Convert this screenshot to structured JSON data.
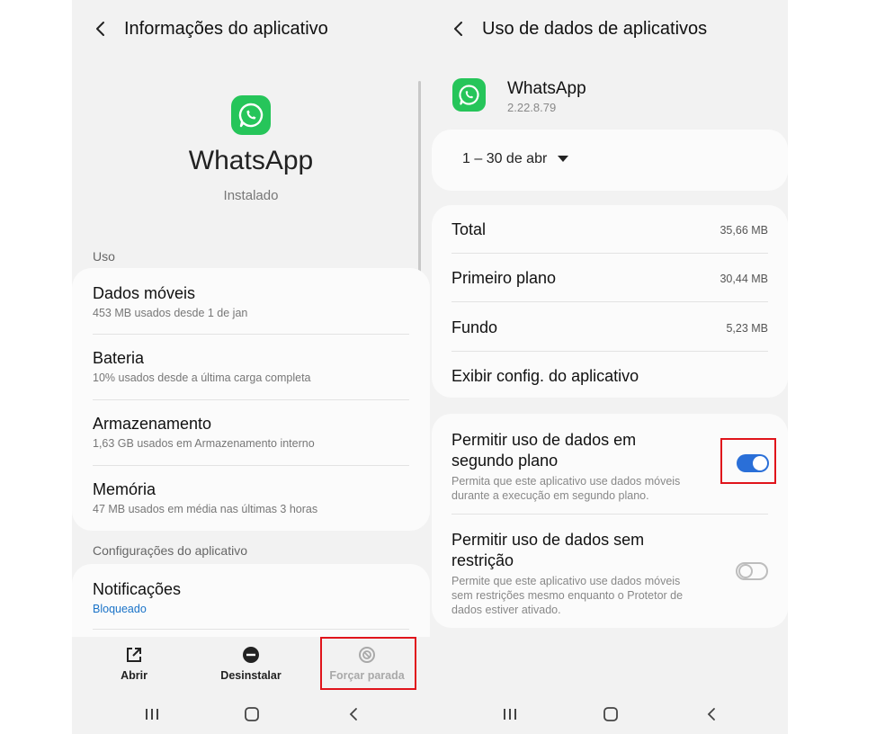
{
  "left": {
    "header": {
      "title": "Informações do aplicativo"
    },
    "app": {
      "name": "WhatsApp",
      "status": "Instalado"
    },
    "uso": {
      "label": "Uso",
      "items": [
        {
          "title": "Dados móveis",
          "subtitle": "453 MB usados desde 1 de jan"
        },
        {
          "title": "Bateria",
          "subtitle": "10% usados desde a última carga completa"
        },
        {
          "title": "Armazenamento",
          "subtitle": "1,63 GB usados em Armazenamento interno"
        },
        {
          "title": "Memória",
          "subtitle": "47 MB usados em média nas últimas 3 horas"
        }
      ]
    },
    "config": {
      "label": "Configurações do aplicativo",
      "notifications": {
        "title": "Notificações",
        "subtitle": "Bloqueado"
      }
    },
    "bottom_actions": {
      "open": "Abrir",
      "uninstall": "Desinstalar",
      "force_stop": "Forçar parada"
    }
  },
  "right": {
    "header": {
      "title": "Uso de dados de aplicativos"
    },
    "app": {
      "name": "WhatsApp",
      "version": "2.22.8.79"
    },
    "date_range": "1 – 30 de abr",
    "usage": [
      {
        "label": "Total",
        "value": "35,66 MB"
      },
      {
        "label": "Primeiro plano",
        "value": "30,44 MB"
      },
      {
        "label": "Fundo",
        "value": "5,23 MB"
      }
    ],
    "view_settings": "Exibir config. do aplicativo",
    "background_data": {
      "title_line1": "Permitir uso de dados em",
      "title_line2": "segundo plano",
      "desc_line1": "Permita que este aplicativo use dados móveis",
      "desc_line2": "durante a execução em segundo plano.",
      "enabled": true
    },
    "unrestricted_data": {
      "title_line1": "Permitir uso de dados sem",
      "title_line2": "restrição",
      "desc_line1": "Permite que este aplicativo use dados móveis",
      "desc_line2": "sem restrições mesmo enquanto o Protetor de",
      "desc_line3": "dados estiver ativado.",
      "enabled": false
    }
  },
  "colors": {
    "accent_blue": "#2a6fd8",
    "link_blue": "#1a73c8",
    "whatsapp_green": "#26c55a",
    "highlight_red": "#e0141b",
    "panel_bg": "#f2f2f2"
  }
}
